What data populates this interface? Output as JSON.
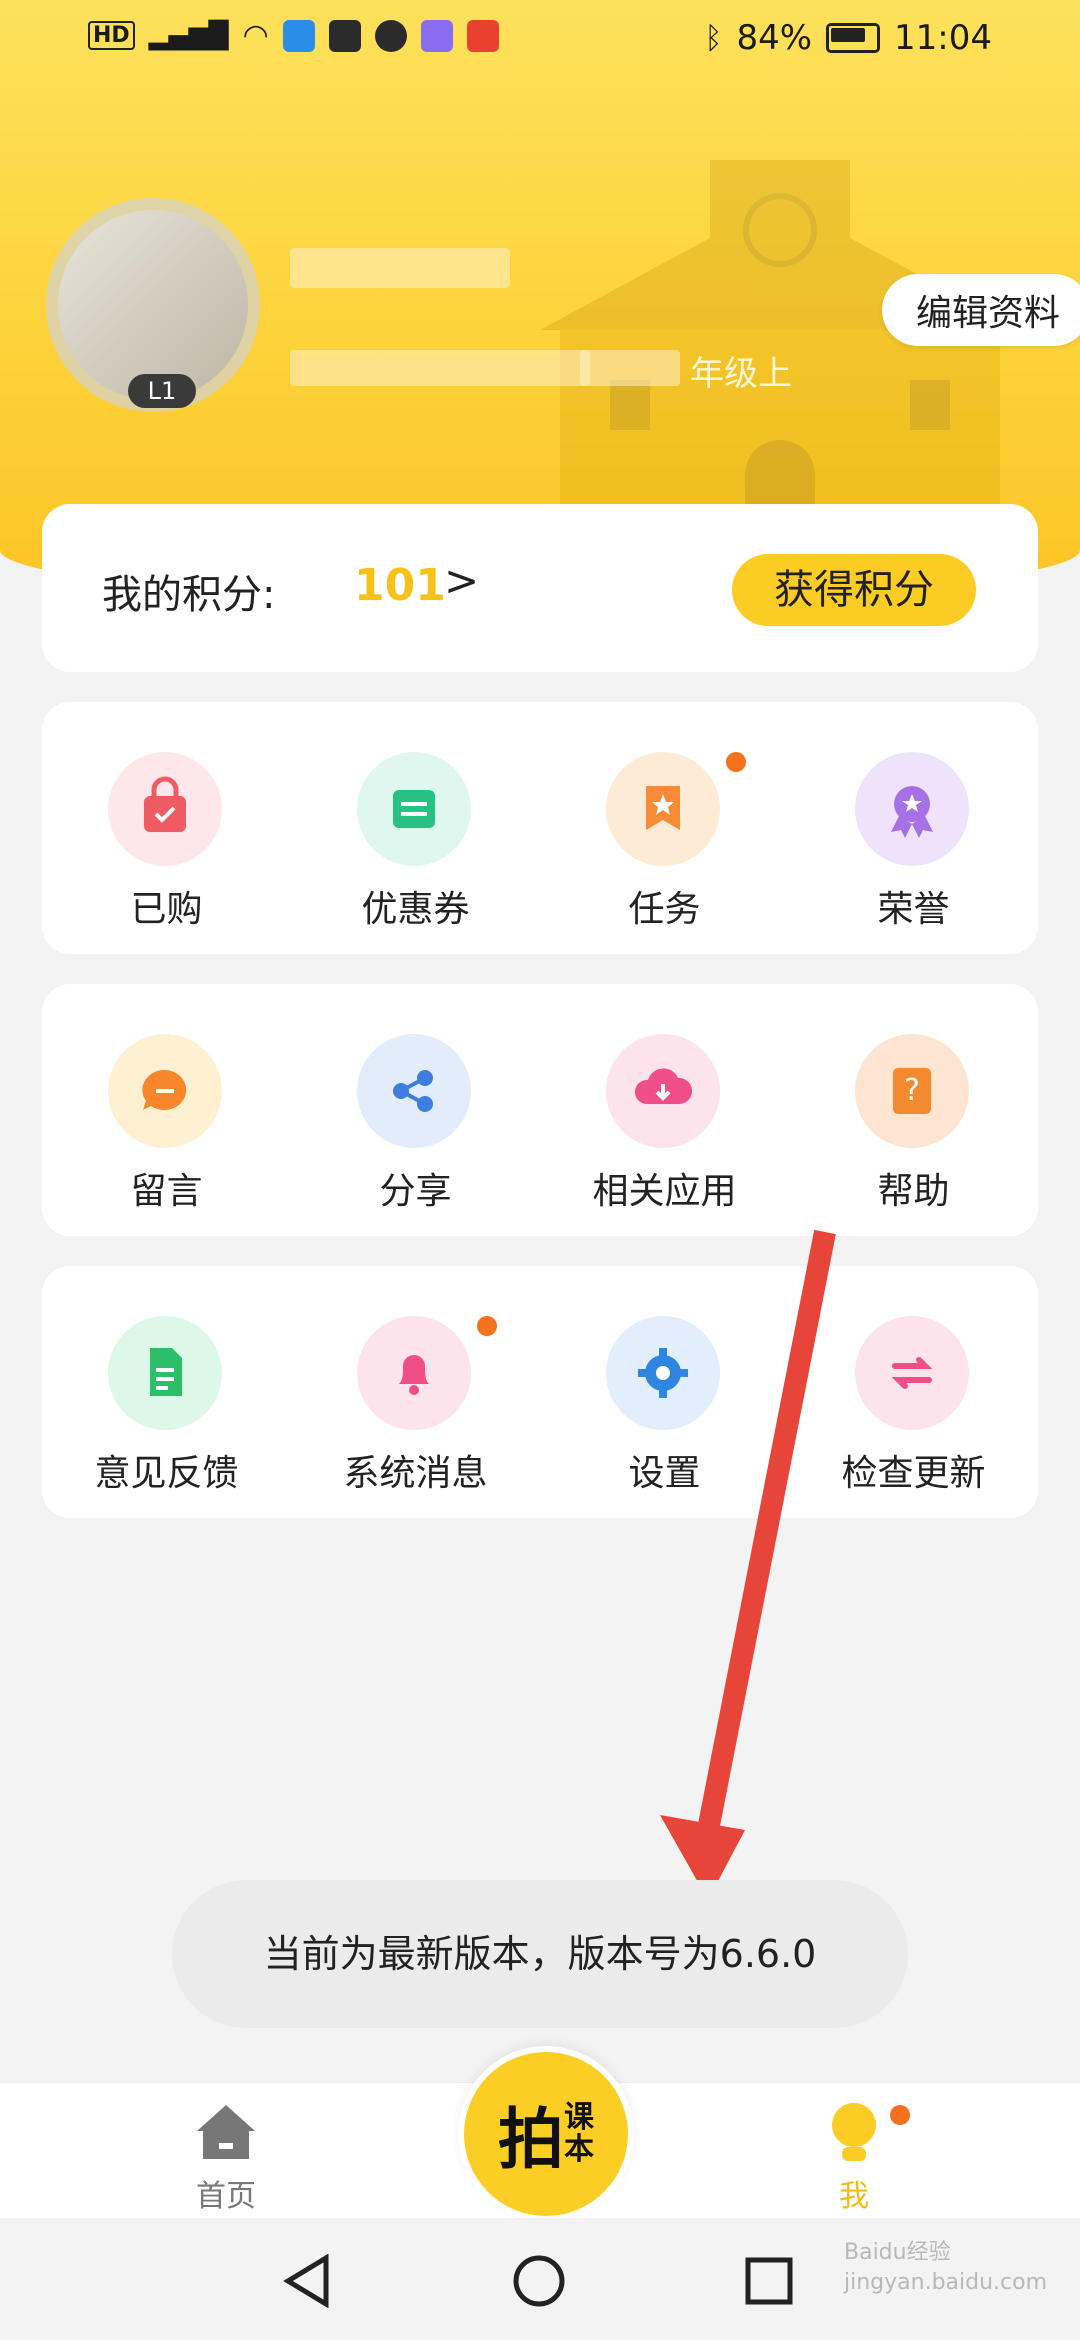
{
  "status_bar": {
    "left_icons": [
      "hd-icon",
      "4g-signal-icon",
      "wifi-icon",
      "weather-icon",
      "huawei-icon",
      "hand-icon",
      "music-icon",
      "app-icon"
    ],
    "net_label": "HD",
    "battery": "84%",
    "time": "11:04"
  },
  "profile": {
    "level_badge": "L1",
    "grade_text": "年级上",
    "edit_button": "编辑资料"
  },
  "points": {
    "label": "我的积分:",
    "value": "101",
    "arrow": ">",
    "earn_button": "获得积分"
  },
  "menu_rows": [
    [
      {
        "label": "已购",
        "icon": "shopping-bag-icon"
      },
      {
        "label": "优惠券",
        "icon": "coupon-icon"
      },
      {
        "label": "任务",
        "icon": "task-ribbon-icon",
        "badge": true
      },
      {
        "label": "荣誉",
        "icon": "medal-icon"
      }
    ],
    [
      {
        "label": "留言",
        "icon": "message-bubble-icon"
      },
      {
        "label": "分享",
        "icon": "share-icon"
      },
      {
        "label": "相关应用",
        "icon": "cloud-download-icon"
      },
      {
        "label": "帮助",
        "icon": "help-book-icon"
      }
    ],
    [
      {
        "label": "意见反馈",
        "icon": "feedback-document-icon"
      },
      {
        "label": "系统消息",
        "icon": "bell-icon",
        "badge": true
      },
      {
        "label": "设置",
        "icon": "gear-icon"
      },
      {
        "label": "检查更新",
        "icon": "refresh-arrows-icon"
      }
    ]
  ],
  "toast": "当前为最新版本，版本号为6.6.0",
  "tabbar": {
    "home": "首页",
    "center_line1": "拍",
    "center_line2": "课",
    "center_line3": "本",
    "me": "我"
  },
  "colors": {
    "accent": "#fbcd24",
    "points_value": "#f6c21a",
    "badge": "#f4711f",
    "annotation_arrow": "#e8453a"
  },
  "watermark": "Baidu经验 jingyan.baidu.com"
}
